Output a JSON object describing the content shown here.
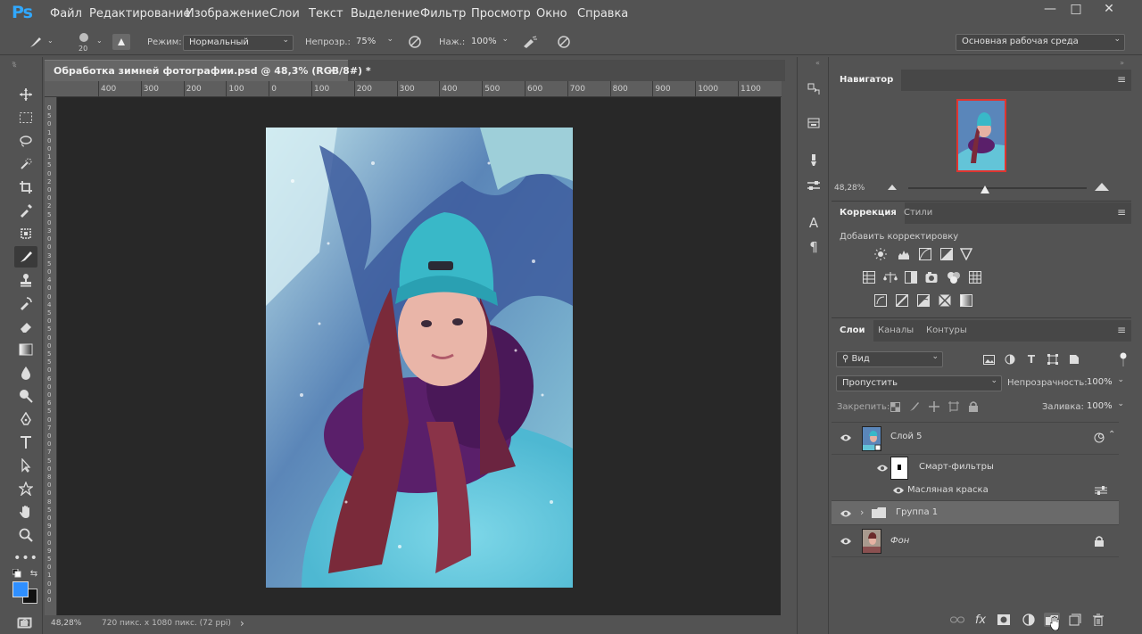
{
  "app": {
    "logo": "Ps",
    "menu": [
      "Файл",
      "Редактирование",
      "Изображение",
      "Слои",
      "Текст",
      "Выделение",
      "Фильтр",
      "Просмотр",
      "Окно",
      "Справка"
    ],
    "window_controls": {
      "minimize": "—",
      "maximize": "□",
      "close": "✕"
    }
  },
  "options_bar": {
    "brush_size": "20",
    "mode_label": "Режим:",
    "mode_value": "Нормальный",
    "opacity_label": "Непрозр.:",
    "opacity_value": "75%",
    "flow_label": "Наж.:",
    "flow_value": "100%",
    "workspace": "Основная рабочая среда"
  },
  "document": {
    "tab_title": "Обработка зимней фотографии.psd @ 48,3% (RGB/8#) *",
    "tab_close": "×",
    "ruler_top": [
      "400",
      "300",
      "200",
      "100",
      "0",
      "100",
      "200",
      "300",
      "400",
      "500",
      "600",
      "700",
      "800",
      "900",
      "1000",
      "1100"
    ],
    "ruler_left": [
      "0",
      "5",
      "0",
      "1",
      "0",
      "0",
      "1",
      "5",
      "0",
      "2",
      "0",
      "0",
      "2",
      "5",
      "0",
      "3",
      "0",
      "0",
      "3",
      "5",
      "0",
      "4",
      "0",
      "0",
      "4",
      "5",
      "0",
      "5",
      "0",
      "0",
      "5",
      "5",
      "0",
      "6",
      "0",
      "0",
      "6",
      "5",
      "0",
      "7",
      "0",
      "0",
      "7",
      "5",
      "0",
      "8",
      "0",
      "0",
      "8",
      "5",
      "0",
      "9",
      "0",
      "0",
      "9",
      "5",
      "0",
      "1",
      "0",
      "0",
      "0"
    ],
    "status_zoom": "48,28%",
    "status_info": "720 пикс. x 1080 пикс. (72 ppi)",
    "status_arrow": "›"
  },
  "navigator": {
    "tab": "Навигатор",
    "zoom": "48,28%"
  },
  "adjustments": {
    "tabs": [
      "Коррекция",
      "Стили"
    ],
    "subtitle": "Добавить корректировку"
  },
  "layers": {
    "tabs": [
      "Слои",
      "Каналы",
      "Контуры"
    ],
    "filter_kind": "Вид",
    "blend_mode": "Пропустить",
    "opacity_label": "Непрозрачность:",
    "opacity_value": "100%",
    "lock_label": "Закрепить:",
    "fill_label": "Заливка:",
    "fill_value": "100%",
    "items": [
      {
        "name": "Слой 5",
        "type": "smart"
      },
      {
        "name": "Смарт-фильтры",
        "type": "filter-mask"
      },
      {
        "name": "Масляная краска",
        "type": "filter"
      },
      {
        "name": "Группа 1",
        "type": "group"
      },
      {
        "name": "Фон",
        "type": "background"
      }
    ]
  },
  "colors": {
    "foreground": "#2f8fff",
    "background": "#111111",
    "accent": "#31a8ff"
  }
}
